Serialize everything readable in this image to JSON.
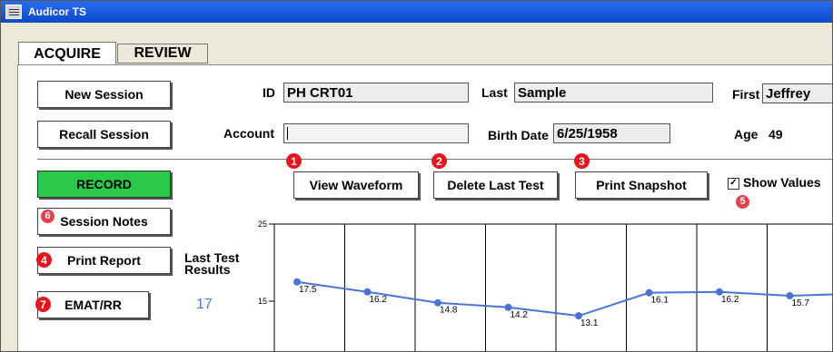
{
  "window": {
    "title": "Audicor TS",
    "icon": "app-icon"
  },
  "tabs": [
    {
      "label": "ACQUIRE",
      "active": true
    },
    {
      "label": "REVIEW",
      "active": false
    }
  ],
  "buttons": {
    "new_session": "New Session",
    "recall_session": "Recall Session",
    "record": "RECORD",
    "session_notes": "Session Notes",
    "print_report": "Print Report",
    "emat_rr": "EMAT/RR",
    "view_waveform": "View Waveform",
    "delete_last_test": "Delete Last Test",
    "print_snapshot": "Print Snapshot"
  },
  "patient": {
    "id_label": "ID",
    "id_value": "PH CRT01",
    "last_label": "Last",
    "last_value": "Sample",
    "first_label": "First",
    "first_value": "Jeffrey",
    "account_label": "Account",
    "account_value": "",
    "birth_label": "Birth Date",
    "birth_value": "6/25/1958",
    "age_label": "Age",
    "age_value": "49"
  },
  "show_values": {
    "label": "Show Values",
    "checked": true,
    "mark": "✓"
  },
  "last_test": {
    "label_line1": "Last Test",
    "label_line2": "Results",
    "value": "17"
  },
  "badges": {
    "view_waveform": "1",
    "delete_last_test": "2",
    "print_snapshot": "3",
    "print_report": "4",
    "show_values": "5",
    "session_notes": "6",
    "emat_rr": "7"
  },
  "colors": {
    "record_green": "#2bc84a",
    "badge_red": "#e8141b",
    "series_blue": "#4a73d8",
    "titlebar_blue": "#0a49c8"
  },
  "chart_data": {
    "type": "line",
    "ylim": [
      0,
      25
    ],
    "y_ticks": [
      "25",
      "15"
    ],
    "x": [
      1,
      2,
      3,
      4,
      5,
      6,
      7,
      8,
      9
    ],
    "series": [
      {
        "values": [
          17.5,
          16.2,
          14.8,
          14.2,
          13.1,
          16.1,
          16.2,
          15.7,
          16.0
        ],
        "labels": [
          "17.5",
          "16.2",
          "14.8",
          "14.2",
          "13.1",
          "16.1",
          "16.2",
          "15.7",
          ""
        ]
      }
    ],
    "grid": true
  }
}
